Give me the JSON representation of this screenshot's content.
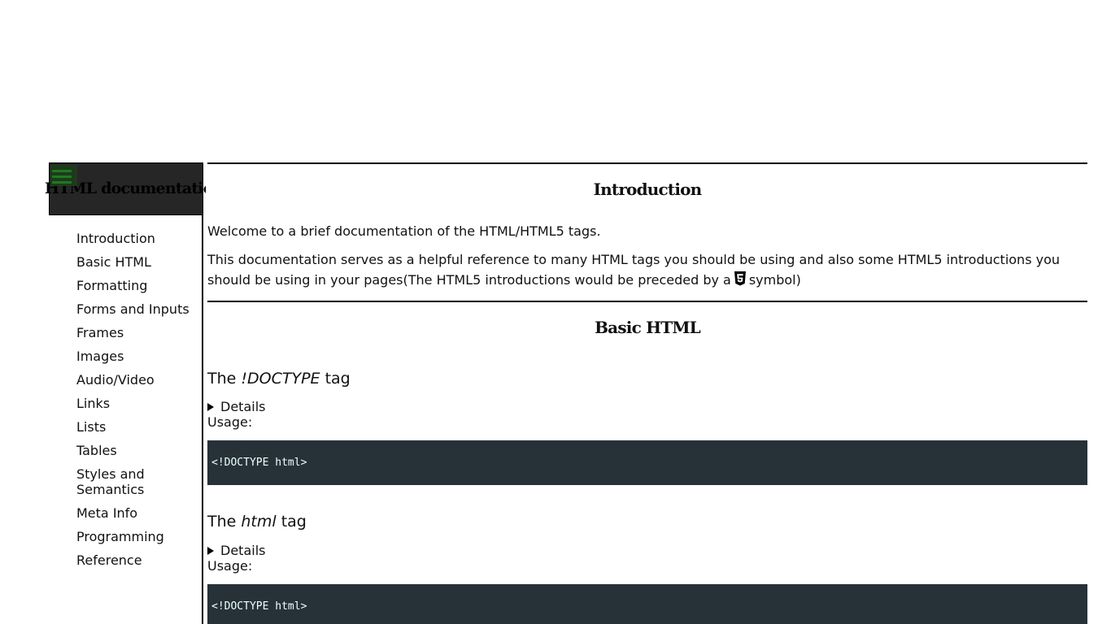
{
  "sidebar": {
    "title": "HTML documentation",
    "menu_icon": "hamburger-menu-icon",
    "items": [
      {
        "label": "Introduction"
      },
      {
        "label": "Basic HTML"
      },
      {
        "label": "Formatting"
      },
      {
        "label": "Forms and Inputs"
      },
      {
        "label": "Frames"
      },
      {
        "label": "Images"
      },
      {
        "label": "Audio/Video"
      },
      {
        "label": "Links"
      },
      {
        "label": "Lists"
      },
      {
        "label": "Tables"
      },
      {
        "label": "Styles and Semantics"
      },
      {
        "label": "Meta Info"
      },
      {
        "label": "Programming"
      },
      {
        "label": "Reference"
      }
    ]
  },
  "intro": {
    "heading": "Introduction",
    "p1": "Welcome to a brief documentation of the HTML/HTML5 tags.",
    "p2_before_icon": "This documentation serves as a helpful reference to many HTML tags you should be using and also some HTML5 introductions you should be using in your pages(The HTML5 introductions would be preceded by a",
    "p2_icon": "html5-icon",
    "p2_after_icon": "symbol)"
  },
  "basic": {
    "heading": "Basic HTML",
    "tags": [
      {
        "prefix": "The",
        "name": "!DOCTYPE",
        "suffix": "tag",
        "details_label": "Details",
        "usage_label": "Usage:",
        "code": "<!DOCTYPE html>"
      },
      {
        "prefix": "The",
        "name": "html",
        "suffix": "tag",
        "details_label": "Details",
        "usage_label": "Usage:",
        "code": "<!DOCTYPE html>"
      }
    ]
  },
  "colors": {
    "sidebar_header_bg": "#262626",
    "code_bg": "#263238",
    "code_text": "#eeffff",
    "menu_icon": "#1f7a1f"
  }
}
